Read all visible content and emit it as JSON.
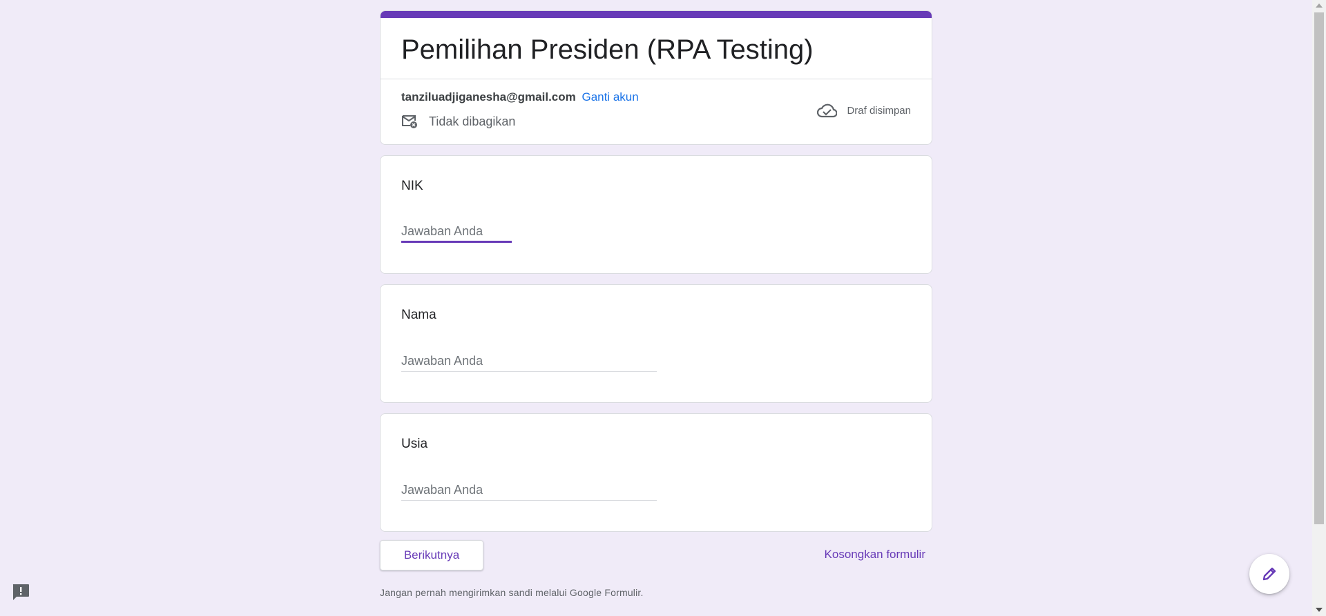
{
  "form": {
    "title": "Pemilihan Presiden (RPA Testing)",
    "account_email": "tanziluadjiganesha@gmail.com",
    "switch_account_label": "Ganti akun",
    "share_status": "Tidak dibagikan",
    "draft_status": "Draf disimpan",
    "accent_color": "#673ab7"
  },
  "questions": [
    {
      "title": "NIK",
      "placeholder": "Jawaban Anda",
      "value": ""
    },
    {
      "title": "Nama",
      "placeholder": "Jawaban Anda",
      "value": ""
    },
    {
      "title": "Usia",
      "placeholder": "Jawaban Anda",
      "value": ""
    }
  ],
  "footer": {
    "next_label": "Berikutnya",
    "clear_label": "Kosongkan formulir",
    "warning": "Jangan pernah mengirimkan sandi melalui Google Formulir."
  },
  "icons": {
    "share": "mail-off-icon",
    "draft": "cloud-done-icon",
    "feedback": "feedback-icon",
    "edit": "pencil-icon"
  }
}
